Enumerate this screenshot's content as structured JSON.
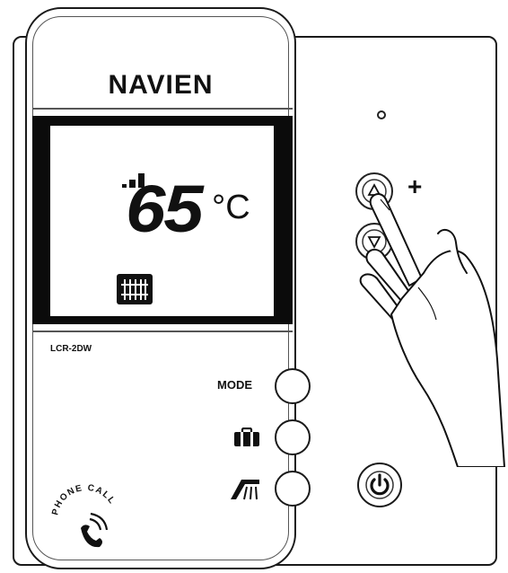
{
  "brand": "NAVIEN",
  "display": {
    "temperature": "65",
    "unit": "°C",
    "signal_bars": 3
  },
  "model": "LCR-2DW",
  "buttons": {
    "mode_label": "MODE",
    "plus_label": "+"
  },
  "phone_call_label": "PHONE CALL",
  "icons": {
    "signal": "signal-bars-icon",
    "heating": "radiator-heating-icon",
    "away": "suitcase-icon",
    "shower": "shower-icon",
    "up": "triangle-up-icon",
    "down": "triangle-down-icon",
    "power": "power-icon",
    "phone": "phone-icon",
    "hand": "hand-pointing-icon"
  }
}
